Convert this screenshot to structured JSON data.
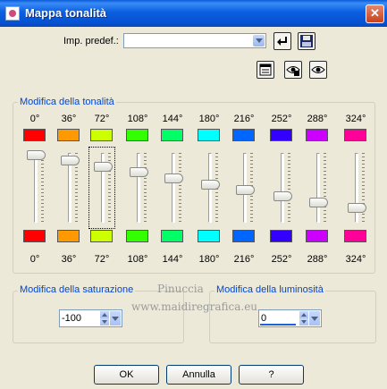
{
  "window": {
    "title": "Mappa tonalità",
    "close": "✕"
  },
  "preset": {
    "label": "Imp. predef.:",
    "value": ""
  },
  "hue_group": {
    "title": "Modifica della tonalità",
    "source_degrees": [
      "0°",
      "36°",
      "72°",
      "108°",
      "144°",
      "180°",
      "216°",
      "252°",
      "288°",
      "324°"
    ],
    "source_colors": [
      "#ff0000",
      "#ff9900",
      "#ccff00",
      "#33ff00",
      "#00ff66",
      "#00ffff",
      "#0066ff",
      "#3300ff",
      "#cc00ff",
      "#ff0099"
    ],
    "target_degrees": [
      "0°",
      "36°",
      "72°",
      "108°",
      "144°",
      "180°",
      "216°",
      "252°",
      "288°",
      "324°"
    ],
    "target_colors": [
      "#ff0000",
      "#ff9900",
      "#ccff00",
      "#33ff00",
      "#00ff66",
      "#00ffff",
      "#0066ff",
      "#3300ff",
      "#cc00ff",
      "#ff0099"
    ],
    "slider_levels": [
      1.0,
      0.92,
      0.83,
      0.74,
      0.65,
      0.56,
      0.47,
      0.38,
      0.29,
      0.2
    ]
  },
  "saturation": {
    "title": "Modifica della saturazione",
    "value": "-100"
  },
  "luminosity": {
    "title": "Modifica della luminosità",
    "value": "0"
  },
  "buttons": {
    "ok": "OK",
    "cancel": "Annulla",
    "help": "?"
  },
  "watermark": {
    "line1": "Pinuccia",
    "line2": "www.maidiregrafica.eu"
  }
}
